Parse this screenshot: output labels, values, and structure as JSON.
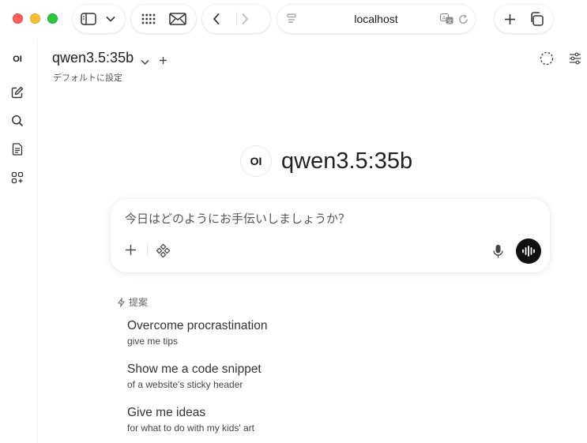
{
  "browser": {
    "address": "localhost"
  },
  "sidebar": {
    "logo_text": "OI"
  },
  "header": {
    "model_name": "qwen3.5:35b",
    "set_default_label": "デフォルトに設定"
  },
  "hero": {
    "logo_text": "OI",
    "title": "qwen3.5:35b"
  },
  "chat_input": {
    "placeholder": "今日はどのようにお手伝いしましょうか？"
  },
  "suggestions": {
    "heading": "提案",
    "items": [
      {
        "title": "Overcome procrastination",
        "subtitle": "give me tips"
      },
      {
        "title": "Show me a code snippet",
        "subtitle": "of a website's sticky header"
      },
      {
        "title": "Give me ideas",
        "subtitle": "for what to do with my kids' art"
      }
    ]
  },
  "colors": {
    "close": "#fe5f57",
    "minimize": "#febc2e",
    "zoom": "#28c840",
    "send_button": "#111111"
  },
  "icons": {
    "traffic_lights": [
      "close-button",
      "minimize-button",
      "zoom-button"
    ],
    "toolbar": [
      "sidebar-toggle-icon",
      "chevron-down-icon",
      "grid-icon",
      "mail-icon",
      "back-arrow-icon",
      "forward-arrow-icon",
      "page-icon",
      "translate-icon",
      "reload-icon",
      "new-tab-icon",
      "tabs-overview-icon"
    ],
    "sidebar": [
      "new-chat-icon",
      "search-icon",
      "notes-icon",
      "workspace-icon"
    ],
    "header": [
      "chevron-down-icon",
      "add-model-icon",
      "temporary-chat-icon",
      "controls-icon"
    ],
    "input": [
      "plus-icon",
      "integrations-icon",
      "microphone-icon",
      "voice-mode-icon"
    ],
    "suggestions": [
      "bolt-icon"
    ]
  }
}
